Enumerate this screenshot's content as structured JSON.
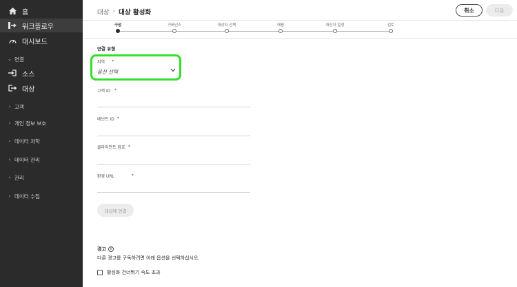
{
  "sidebar": {
    "items": [
      {
        "label": "홈",
        "icon": "home-icon"
      },
      {
        "label": "워크플로우",
        "icon": "workflow-icon"
      },
      {
        "label": "대시보드",
        "icon": "dashboard-icon"
      },
      {
        "label": "연결",
        "icon": "chevron-down-icon"
      },
      {
        "label": "소스",
        "icon": "source-icon"
      },
      {
        "label": "대상",
        "icon": "destination-icon"
      },
      {
        "label": "고객",
        "icon": "chevron-right-icon"
      },
      {
        "label": "개인 정보 보호",
        "icon": "chevron-right-icon"
      },
      {
        "label": "데이터 과학",
        "icon": "chevron-right-icon"
      },
      {
        "label": "데이터 관리",
        "icon": "chevron-right-icon"
      },
      {
        "label": "관리",
        "icon": "chevron-right-icon"
      },
      {
        "label": "데이터 수집",
        "icon": "chevron-right-icon"
      }
    ]
  },
  "header": {
    "breadcrumb_parent": "대상",
    "breadcrumb_separator": "›",
    "title": "대상 활성화",
    "cancel_label": "취소",
    "next_label": "다음"
  },
  "stepper": {
    "steps": [
      {
        "label": "구성",
        "active": true
      },
      {
        "label": "거버넌스",
        "active": false
      },
      {
        "label": "대상자 선택",
        "active": false
      },
      {
        "label": "매핑",
        "active": false
      },
      {
        "label": "대상자 일정",
        "active": false
      },
      {
        "label": "검토",
        "active": false
      }
    ]
  },
  "form": {
    "section_title": "연결 유형",
    "required_mark": "*",
    "region_label": "지역",
    "region_value": "옵션 선택",
    "customer_id_label": "고객 ID",
    "tenant_id_label": "테넌트 ID",
    "client_password_label": "클라이언트 암호",
    "env_url_label": "환경 URL",
    "connect_button": "대상에 연결"
  },
  "alerts": {
    "title": "경고",
    "description": "다른 경고를 구독하려면 아래 옵션을 선택하십시오.",
    "checkbox_label": "활성화 건너뛰기 속도 초과",
    "checkbox_checked": false
  },
  "colors": {
    "sidebar_bg": "#2b2b2b",
    "highlight": "#2fe024"
  }
}
